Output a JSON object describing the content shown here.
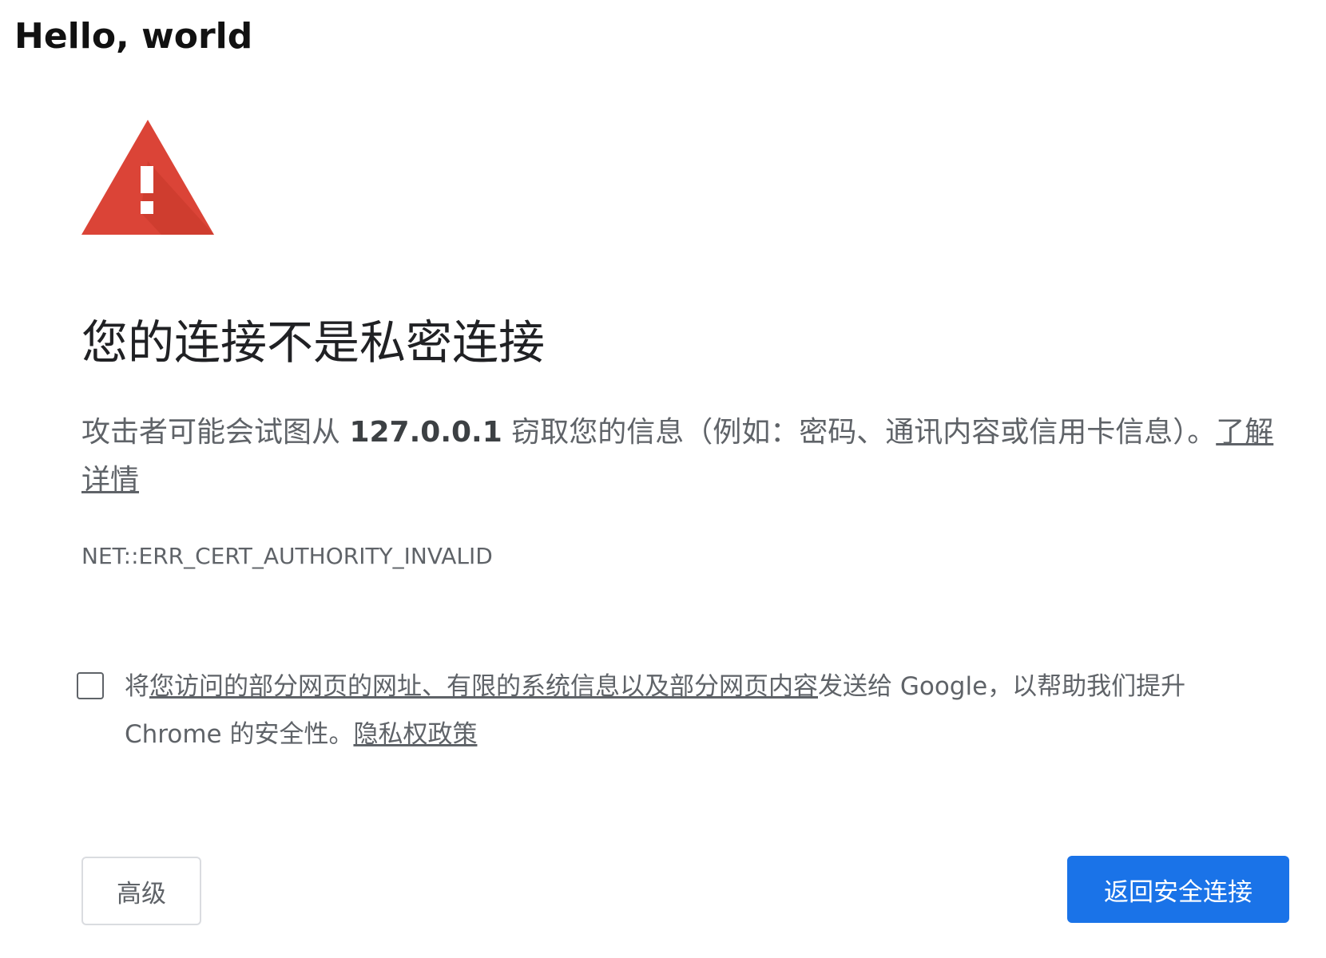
{
  "page": {
    "heading": "Hello, world"
  },
  "interstitial": {
    "icon": "warning-triangle-icon",
    "icon_color": "#db4437",
    "title": "您的连接不是私密连接",
    "message": {
      "before_host": "攻击者可能会试图从 ",
      "host": "127.0.0.1",
      "after_host": " 窃取您的信息（例如：密码、通讯内容或信用卡信息）。",
      "learn_more": "了解详情"
    },
    "error_code": "NET::ERR_CERT_AUTHORITY_INVALID",
    "optin": {
      "checked": false,
      "prefix": "将",
      "underlined": "您访问的部分网页的网址、有限的系统信息以及部分网页内容",
      "middle": "发送给 Google，以帮助我们提升 Chrome 的安全性。",
      "privacy_link": "隐私权政策"
    },
    "buttons": {
      "advanced": "高级",
      "back_to_safety": "返回安全连接"
    },
    "colors": {
      "primary_button": "#1a73e8",
      "text": "#5f6368"
    }
  }
}
